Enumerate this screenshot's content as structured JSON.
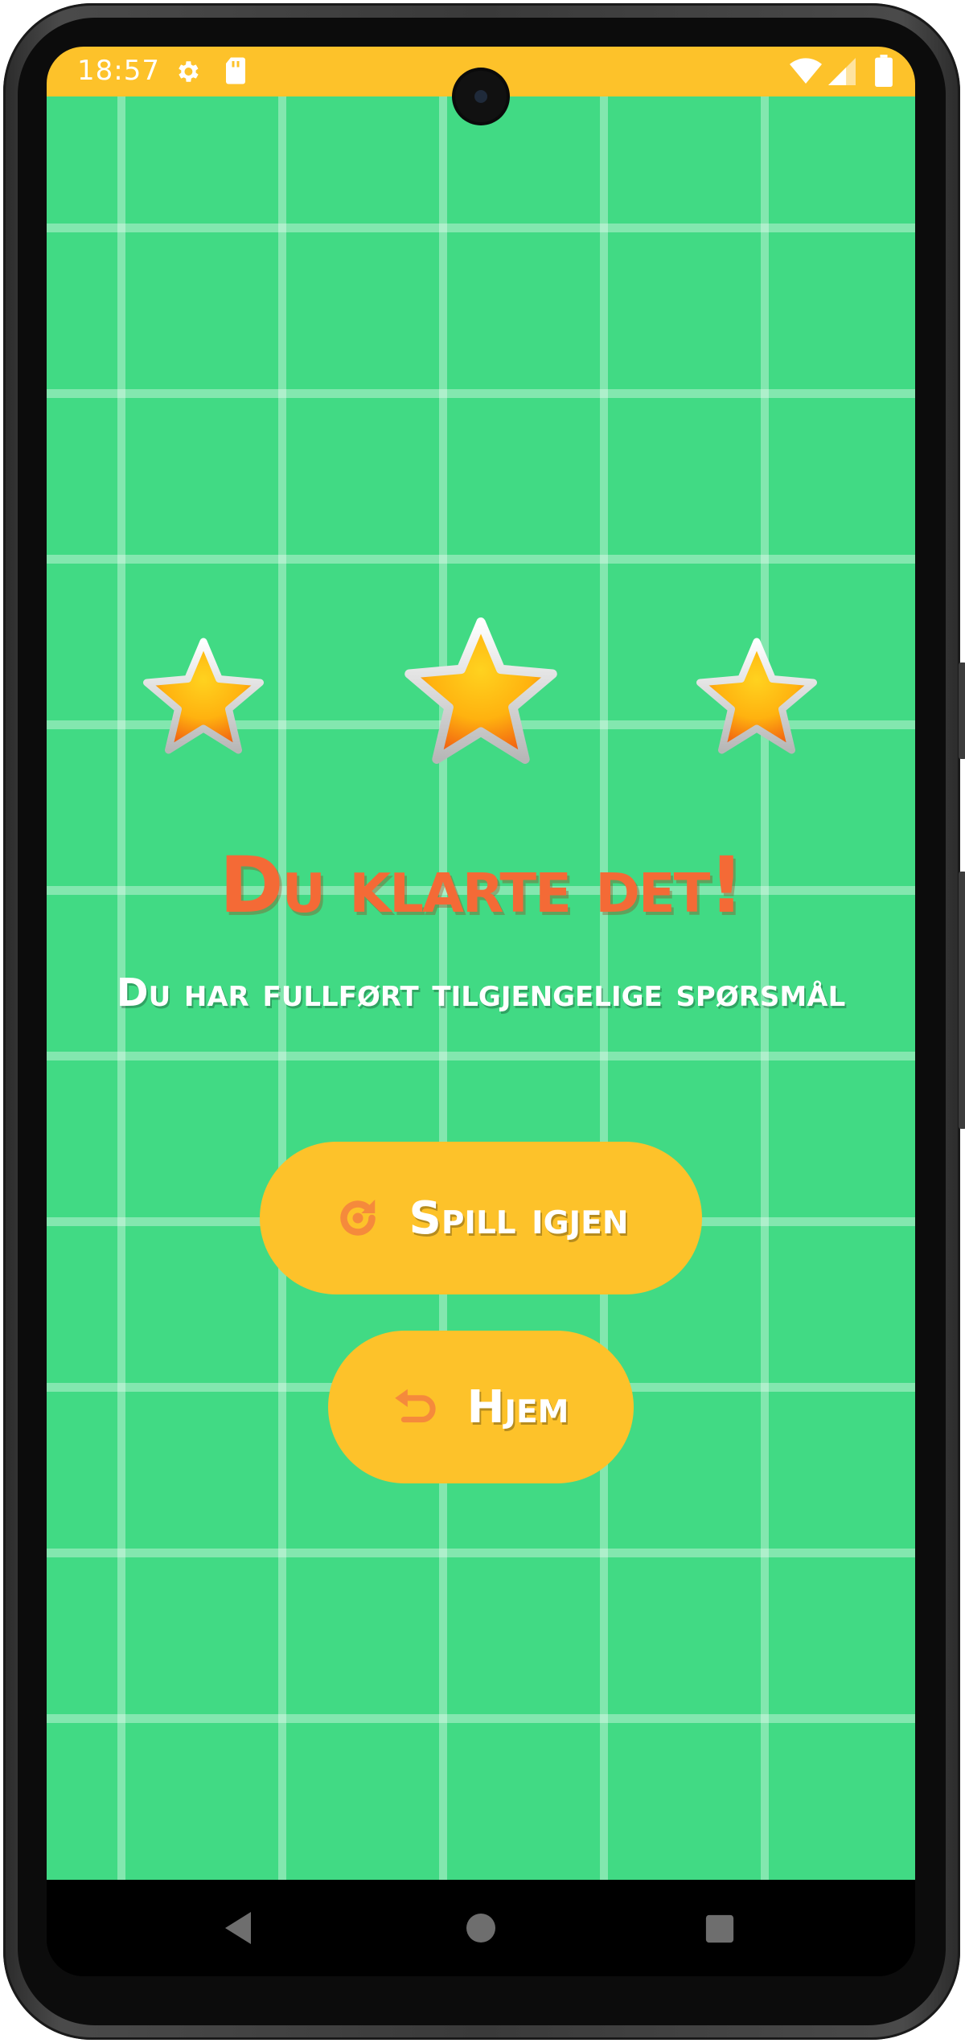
{
  "status_bar": {
    "time": "18:57",
    "color": "#fdc22a",
    "icons": [
      "settings-icon",
      "sd-card-icon",
      "wifi-icon",
      "signal-icon",
      "battery-icon"
    ]
  },
  "game_screen": {
    "background_color": "#41da84",
    "stars": {
      "earned": 3,
      "total": 3
    },
    "title": "Du klarte det!",
    "title_color": "#f46a36",
    "subtitle": "Du har fullført tilgjengelige spørsmål",
    "buttons": {
      "play_again": {
        "label": "Spill igjen",
        "icon": "replay-icon"
      },
      "home": {
        "label": "Hjem",
        "icon": "undo-arrow-icon"
      }
    },
    "button_color": "#fdc22a",
    "button_icon_color": "#f58a3c"
  },
  "nav_bar": {
    "icons": [
      "back-triangle-icon",
      "home-circle-icon",
      "recents-square-icon"
    ]
  }
}
